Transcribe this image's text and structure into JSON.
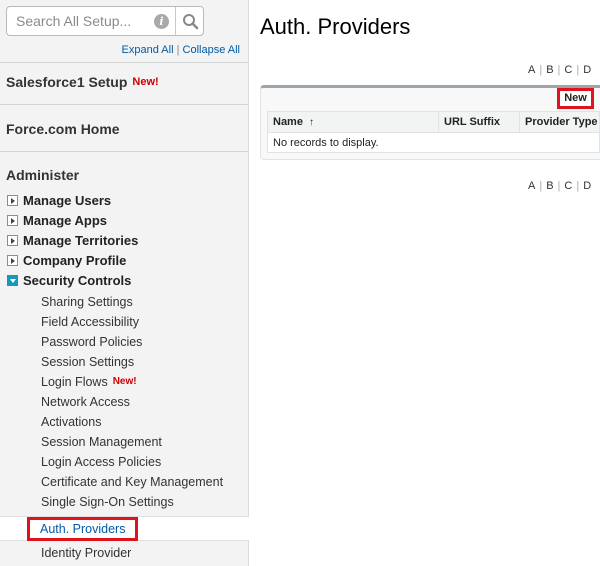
{
  "search": {
    "placeholder": "Search All Setup..."
  },
  "sidebar": {
    "expand_all": "Expand All",
    "separator": "|",
    "collapse_all": "Collapse All",
    "salesforce1_setup": "Salesforce1 Setup",
    "new_badge": "New!",
    "force_home": "Force.com Home",
    "administer": "Administer",
    "tree": [
      {
        "label": "Manage Users"
      },
      {
        "label": "Manage Apps"
      },
      {
        "label": "Manage Territories"
      },
      {
        "label": "Company Profile"
      },
      {
        "label": "Security Controls"
      }
    ],
    "security_items": [
      {
        "label": "Sharing Settings"
      },
      {
        "label": "Field Accessibility"
      },
      {
        "label": "Password Policies"
      },
      {
        "label": "Session Settings"
      },
      {
        "label": "Login Flows",
        "badge": "New!"
      },
      {
        "label": "Network Access"
      },
      {
        "label": "Activations"
      },
      {
        "label": "Session Management"
      },
      {
        "label": "Login Access Policies"
      },
      {
        "label": "Certificate and Key Management"
      },
      {
        "label": "Single Sign-On Settings"
      },
      {
        "label": "Auth. Providers"
      },
      {
        "label": "Identity Provider"
      }
    ]
  },
  "main": {
    "title": "Auth. Providers",
    "alpha": [
      "A",
      "B",
      "C",
      "D"
    ],
    "new_button": "New",
    "columns": [
      {
        "label": "Name",
        "sort": "↑"
      },
      {
        "label": "URL Suffix"
      },
      {
        "label": "Provider Type"
      }
    ],
    "empty_message": "No records to display."
  }
}
